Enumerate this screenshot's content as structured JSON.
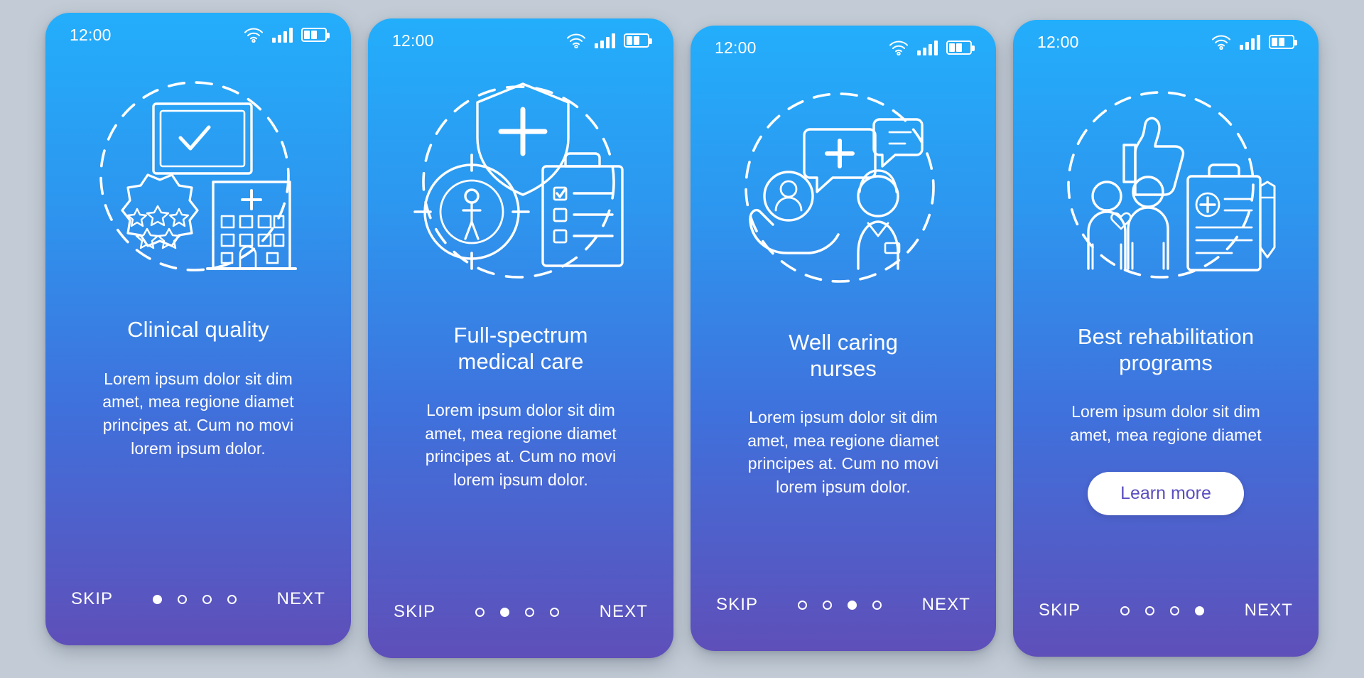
{
  "screens": [
    {
      "id": "clinical-quality",
      "status": {
        "time": "12:00",
        "wifi_icon": "wifi-icon",
        "signal_icon": "signal-bars-icon",
        "battery_icon": "battery-icon"
      },
      "illustration": "clinical-quality-illustration",
      "title": "Clinical quality",
      "body": "Lorem ipsum dolor sit dim amet, mea regione diamet principes at. Cum no movi lorem ipsum dolor.",
      "cta": null,
      "nav": {
        "skip": "SKIP",
        "next": "NEXT",
        "dots": 4,
        "active": 0
      }
    },
    {
      "id": "full-spectrum-medical-care",
      "status": {
        "time": "12:00",
        "wifi_icon": "wifi-icon",
        "signal_icon": "signal-bars-icon",
        "battery_icon": "battery-icon"
      },
      "illustration": "medical-care-illustration",
      "title": "Full-spectrum\nmedical care",
      "body": "Lorem ipsum dolor sit dim amet, mea regione diamet principes at. Cum no movi lorem ipsum dolor.",
      "cta": null,
      "nav": {
        "skip": "SKIP",
        "next": "NEXT",
        "dots": 4,
        "active": 1
      }
    },
    {
      "id": "well-caring-nurses",
      "status": {
        "time": "12:00",
        "wifi_icon": "wifi-icon",
        "signal_icon": "signal-bars-icon",
        "battery_icon": "battery-icon"
      },
      "illustration": "nurses-illustration",
      "title": "Well caring\nnurses",
      "body": "Lorem ipsum dolor sit dim amet, mea regione diamet principes at. Cum no movi lorem ipsum dolor.",
      "cta": null,
      "nav": {
        "skip": "SKIP",
        "next": "NEXT",
        "dots": 4,
        "active": 2
      }
    },
    {
      "id": "best-rehabilitation-programs",
      "status": {
        "time": "12:00",
        "wifi_icon": "wifi-icon",
        "signal_icon": "signal-bars-icon",
        "battery_icon": "battery-icon"
      },
      "illustration": "rehabilitation-illustration",
      "title": "Best rehabilitation\nprograms",
      "body": "Lorem ipsum dolor sit dim amet, mea regione diamet",
      "cta": "Learn more",
      "nav": {
        "skip": "SKIP",
        "next": "NEXT",
        "dots": 4,
        "active": 3
      }
    }
  ],
  "colors": {
    "page_background": "#c3ccd6",
    "gradient_top": "#23aefb",
    "gradient_bottom": "#5f4fb9",
    "text": "#ffffff",
    "cta_background": "#ffffff",
    "cta_text": "#5b4fc0"
  }
}
